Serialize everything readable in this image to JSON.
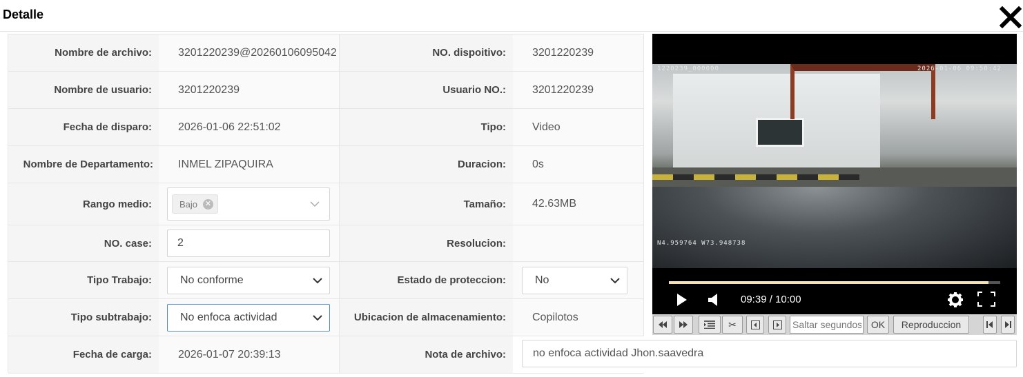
{
  "dialog": {
    "title": "Detalle"
  },
  "fields": {
    "nombre_archivo": {
      "label": "Nombre de archivo:",
      "value": "3201220239@20260106095042"
    },
    "no_dispositivo": {
      "label": "NO. dispoitivo:",
      "value": "3201220239"
    },
    "nombre_usuario": {
      "label": "Nombre de usuario:",
      "value": "3201220239"
    },
    "usuario_no": {
      "label": "Usuario NO.:",
      "value": "3201220239"
    },
    "fecha_disparo": {
      "label": "Fecha de disparo:",
      "value": "2026-01-06 22:51:02"
    },
    "tipo": {
      "label": "Tipo:",
      "value": "Video"
    },
    "departamento": {
      "label": "Nombre de Departamento:",
      "value": "INMEL ZIPAQUIRA"
    },
    "duracion": {
      "label": "Duracion:",
      "value": "0s"
    },
    "rango_medio": {
      "label": "Rango medio:",
      "tag": "Bajo"
    },
    "tamano": {
      "label": "Tamaño:",
      "value": "42.63MB"
    },
    "no_case": {
      "label": "NO. case:",
      "value": "2"
    },
    "resolucion": {
      "label": "Resolucion:",
      "value": ""
    },
    "tipo_trabajo": {
      "label": "Tipo Trabajo:",
      "value": "No conforme"
    },
    "estado_proteccion": {
      "label": "Estado de proteccion:",
      "value": "No"
    },
    "tipo_subtrabajo": {
      "label": "Tipo subtrabajo:",
      "value": "No enfoca actividad"
    },
    "ubicacion": {
      "label": "Ubicacion de almacenamiento:",
      "value": "Copilotos"
    },
    "fecha_carga": {
      "label": "Fecha de carga:",
      "value": "2026-01-07 20:39:13"
    },
    "nota": {
      "label": "Nota de archivo:",
      "value": "no enfoca actividad Jhon.saavedra"
    }
  },
  "video": {
    "osd_id": "1220239_000000",
    "osd_datetime": "2026-01-06 09:50:42",
    "osd_gps": "N4.959764  W73.948738",
    "time_display": "09:39 / 10:00",
    "progress": 0.965
  },
  "toolbar": {
    "seek_placeholder": "Saltar segundos",
    "ok_label": "OK",
    "playback_label": "Reproduccion"
  }
}
